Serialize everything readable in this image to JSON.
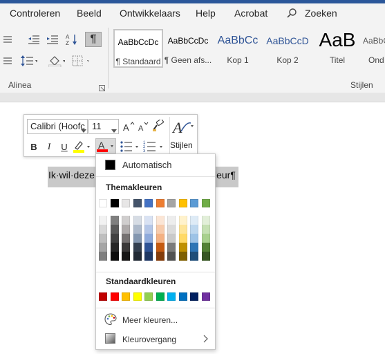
{
  "menu": {
    "items": [
      "Controleren",
      "Beeld",
      "Ontwikkelaars",
      "Help",
      "Acrobat"
    ],
    "search_label": "Zoeken"
  },
  "ribbon": {
    "paragraph_group_label": "Alinea",
    "styles_group_label": "Stijlen",
    "styles": [
      {
        "preview": "AaBbCcDc",
        "label": "¶ Standaard",
        "color": "#000000"
      },
      {
        "preview": "AaBbCcDc",
        "label": "¶ Geen afs...",
        "color": "#000000"
      },
      {
        "preview": "AaBbCc",
        "label": "Kop 1",
        "color": "#2f5496"
      },
      {
        "preview": "AaBbCcD",
        "label": "Kop 2",
        "color": "#2f5496"
      },
      {
        "preview": "AaB",
        "label": "Titel",
        "color": "#000000"
      },
      {
        "preview": "AaBbCcDc",
        "label": "Ond",
        "color": "#595959"
      }
    ]
  },
  "mini_toolbar": {
    "font_name": "Calibri (Hoofc",
    "font_size": "11",
    "styles_label": "Stijlen",
    "font_color": "#ff0000",
    "highlight_color": "#ffff00"
  },
  "document": {
    "selected_text_start": "Ik·wil·deze·",
    "selected_text_end": "leur¶"
  },
  "color_menu": {
    "automatic_label": "Automatisch",
    "theme_heading": "Themakleuren",
    "standard_heading": "Standaardkleuren",
    "more_colors_label": "Meer kleuren...",
    "gradient_label": "Kleurovergang",
    "theme_colors": [
      [
        "#ffffff",
        "#f2f2f2",
        "#d9d9d9",
        "#bfbfbf",
        "#a6a6a6",
        "#808080"
      ],
      [
        "#000000",
        "#7f7f7f",
        "#595959",
        "#404040",
        "#262626",
        "#0d0d0d"
      ],
      [
        "#e7e6e6",
        "#d0cece",
        "#aeaaaa",
        "#757171",
        "#3a3838",
        "#171616"
      ],
      [
        "#44546a",
        "#d6dce4",
        "#adb9ca",
        "#8497b0",
        "#333f4f",
        "#222a35"
      ],
      [
        "#4472c4",
        "#d9e2f3",
        "#b4c6e7",
        "#8eaadb",
        "#2f5496",
        "#1f3864"
      ],
      [
        "#ed7d31",
        "#fbe5d5",
        "#f7cbac",
        "#f4b183",
        "#c55a11",
        "#833c0b"
      ],
      [
        "#a5a5a5",
        "#ededed",
        "#dbdbdb",
        "#c9c9c9",
        "#7b7b7b",
        "#525252"
      ],
      [
        "#ffc000",
        "#fff2cc",
        "#fee599",
        "#ffd966",
        "#bf9000",
        "#7f6000"
      ],
      [
        "#5b9bd5",
        "#deebf6",
        "#bdd7ee",
        "#9dc3e6",
        "#2e75b5",
        "#1f4e79"
      ],
      [
        "#70ad47",
        "#e2efd9",
        "#c5e0b3",
        "#a8d08d",
        "#538135",
        "#375623"
      ]
    ],
    "standard_colors": [
      "#c00000",
      "#ff0000",
      "#ffc000",
      "#ffff00",
      "#92d050",
      "#00b050",
      "#00b0f0",
      "#0070c0",
      "#002060",
      "#7030a0"
    ]
  }
}
